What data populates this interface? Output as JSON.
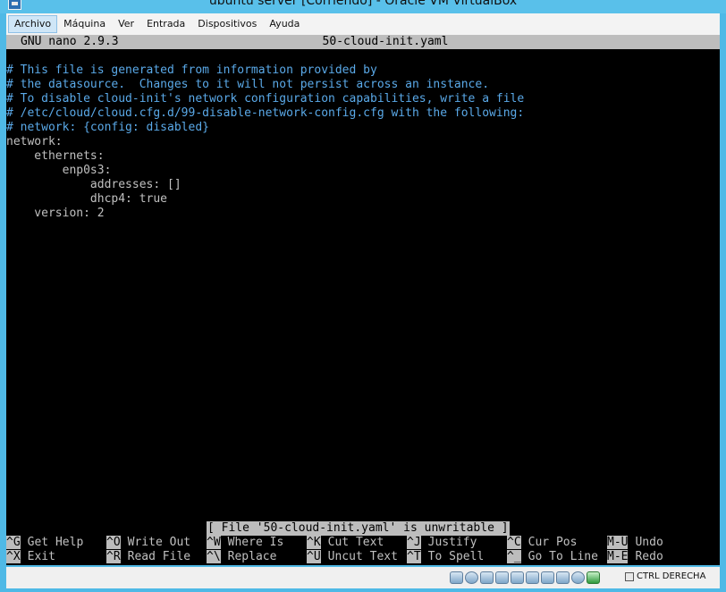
{
  "window": {
    "title": "ubuntu server [Corriendo] - Oracle VM VirtualBox"
  },
  "menu": [
    {
      "label": "Archivo",
      "active": true
    },
    {
      "label": "Máquina",
      "active": false
    },
    {
      "label": "Ver",
      "active": false
    },
    {
      "label": "Entrada",
      "active": false
    },
    {
      "label": "Dispositivos",
      "active": false
    },
    {
      "label": "Ayuda",
      "active": false
    }
  ],
  "nano": {
    "version": "GNU nano 2.9.3",
    "filename": "50-cloud-init.yaml",
    "lines": [
      {
        "text": "# This file is generated from information provided by",
        "comment": true
      },
      {
        "text": "# the datasource.  Changes to it will not persist across an instance.",
        "comment": true
      },
      {
        "text": "# To disable cloud-init's network configuration capabilities, write a file",
        "comment": true
      },
      {
        "text": "# /etc/cloud/cloud.cfg.d/99-disable-network-config.cfg with the following:",
        "comment": true
      },
      {
        "text": "# network: {config: disabled}",
        "comment": true
      },
      {
        "text": "network:",
        "comment": false
      },
      {
        "text": "    ethernets:",
        "comment": false
      },
      {
        "text": "        enp0s3:",
        "comment": false
      },
      {
        "text": "            addresses: []",
        "comment": false
      },
      {
        "text": "            dhcp4: true",
        "comment": false
      },
      {
        "text": "    version: 2",
        "comment": false
      }
    ],
    "status_message": "[ File '50-cloud-init.yaml' is unwritable ]",
    "shortcuts": [
      [
        {
          "key": "^G",
          "label": "Get Help"
        },
        {
          "key": "^O",
          "label": "Write Out"
        },
        {
          "key": "^W",
          "label": "Where Is"
        },
        {
          "key": "^K",
          "label": "Cut Text"
        },
        {
          "key": "^J",
          "label": "Justify"
        },
        {
          "key": "^C",
          "label": "Cur Pos"
        },
        {
          "key": "M-U",
          "label": "Undo"
        }
      ],
      [
        {
          "key": "^X",
          "label": "Exit"
        },
        {
          "key": "^R",
          "label": "Read File"
        },
        {
          "key": "^\\",
          "label": "Replace"
        },
        {
          "key": "^U",
          "label": "Uncut Text"
        },
        {
          "key": "^T",
          "label": "To Spell"
        },
        {
          "key": "^_",
          "label": "Go To Line"
        },
        {
          "key": "M-E",
          "label": "Redo"
        }
      ]
    ]
  },
  "statusbar": {
    "icons": [
      "hard-disk-icon",
      "optical-drive-icon",
      "audio-icon",
      "network-icon",
      "usb-icon",
      "shared-folder-icon",
      "display-icon",
      "video-capture-icon",
      "recording-icon",
      "mouse-integration-icon"
    ],
    "host_key": "CTRL DERECHA"
  }
}
